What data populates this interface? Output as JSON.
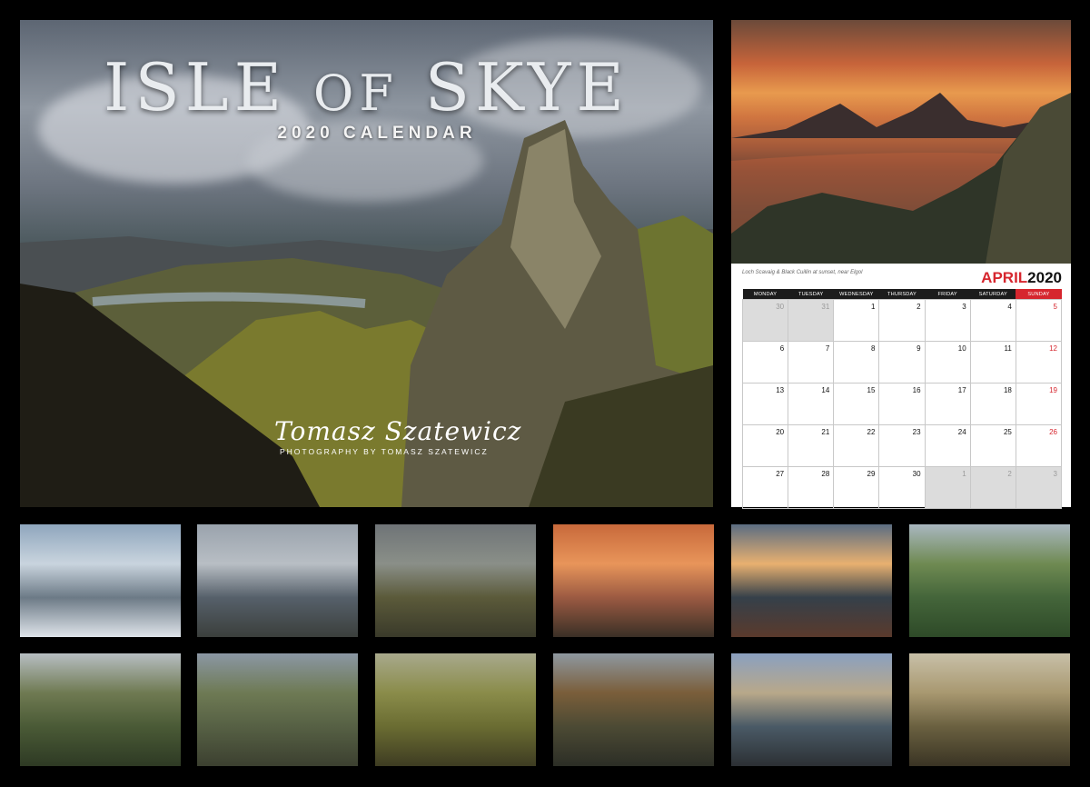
{
  "cover": {
    "title_main": "ISLE",
    "title_of": "OF",
    "title_end": "SKYE",
    "subtitle": "2020 CALENDAR",
    "signature": "Tomasz Szatewicz",
    "photo_credit": "PHOTOGRAPHY BY TOMASZ SZATEWICZ"
  },
  "calendar_page": {
    "caption": "Loch Scavaig & Black Cuillin at sunset, near Elgol",
    "month": "APRIL",
    "year": "2020",
    "weekdays": [
      "MONDAY",
      "TUESDAY",
      "WEDNESDAY",
      "THURSDAY",
      "FRIDAY",
      "SATURDAY",
      "SUNDAY"
    ],
    "weeks": [
      [
        {
          "d": "30",
          "dim": true
        },
        {
          "d": "31",
          "dim": true
        },
        {
          "d": "1"
        },
        {
          "d": "2"
        },
        {
          "d": "3"
        },
        {
          "d": "4"
        },
        {
          "d": "5",
          "sun": true
        }
      ],
      [
        {
          "d": "6"
        },
        {
          "d": "7"
        },
        {
          "d": "8"
        },
        {
          "d": "9"
        },
        {
          "d": "10"
        },
        {
          "d": "11"
        },
        {
          "d": "12",
          "sun": true
        }
      ],
      [
        {
          "d": "13"
        },
        {
          "d": "14"
        },
        {
          "d": "15"
        },
        {
          "d": "16"
        },
        {
          "d": "17"
        },
        {
          "d": "18"
        },
        {
          "d": "19",
          "sun": true
        }
      ],
      [
        {
          "d": "20"
        },
        {
          "d": "21"
        },
        {
          "d": "22"
        },
        {
          "d": "23"
        },
        {
          "d": "24"
        },
        {
          "d": "25"
        },
        {
          "d": "26",
          "sun": true
        }
      ],
      [
        {
          "d": "27"
        },
        {
          "d": "28"
        },
        {
          "d": "29"
        },
        {
          "d": "30"
        },
        {
          "d": "1",
          "dim": true
        },
        {
          "d": "2",
          "dim": true
        },
        {
          "d": "3",
          "dim": true
        }
      ]
    ]
  },
  "thumbnails": [
    {
      "name": "snowy-river-mountain",
      "colors": [
        "#8fa6bd",
        "#c9d4de",
        "#6c7a86",
        "#dfe4ea"
      ]
    },
    {
      "name": "loch-snowy-peaks",
      "colors": [
        "#9aa3ad",
        "#b8bec4",
        "#56606a",
        "#3b3f3c"
      ]
    },
    {
      "name": "quiraing-rock-towers",
      "colors": [
        "#6f7477",
        "#8a8f88",
        "#5b5a3a",
        "#3a3a2a"
      ]
    },
    {
      "name": "sunset-cuillin-loch",
      "colors": [
        "#c8693b",
        "#e8955a",
        "#9b5a42",
        "#3a3026"
      ]
    },
    {
      "name": "neist-point-lighthouse-sunset",
      "colors": [
        "#5b6d82",
        "#e8b070",
        "#35404a",
        "#5a3a2c"
      ]
    },
    {
      "name": "portree-harbour-tree",
      "colors": [
        "#a9b7c0",
        "#6f8a52",
        "#44653a",
        "#2e4a28"
      ]
    },
    {
      "name": "waterfall-green-slope",
      "colors": [
        "#b7bec2",
        "#6f7a52",
        "#4a5a36",
        "#2e3a24"
      ]
    },
    {
      "name": "fairy-pools-stream",
      "colors": [
        "#8b97a4",
        "#6e7a54",
        "#566044",
        "#3c4030"
      ]
    },
    {
      "name": "quiraing-green-hills",
      "colors": [
        "#a8a98c",
        "#8a8c4a",
        "#6a6c32",
        "#3e3c22"
      ]
    },
    {
      "name": "autumn-waterfall-gorge",
      "colors": [
        "#8e98a0",
        "#7a5e3a",
        "#4c4a34",
        "#2c2e26"
      ]
    },
    {
      "name": "sligachan-red-cuillin",
      "colors": [
        "#8aa0c0",
        "#b8a88a",
        "#4a5a66",
        "#2c3034"
      ]
    },
    {
      "name": "old-man-of-storr-dawn",
      "colors": [
        "#c8c0a8",
        "#a89870",
        "#6a6040",
        "#3a3424"
      ]
    }
  ]
}
